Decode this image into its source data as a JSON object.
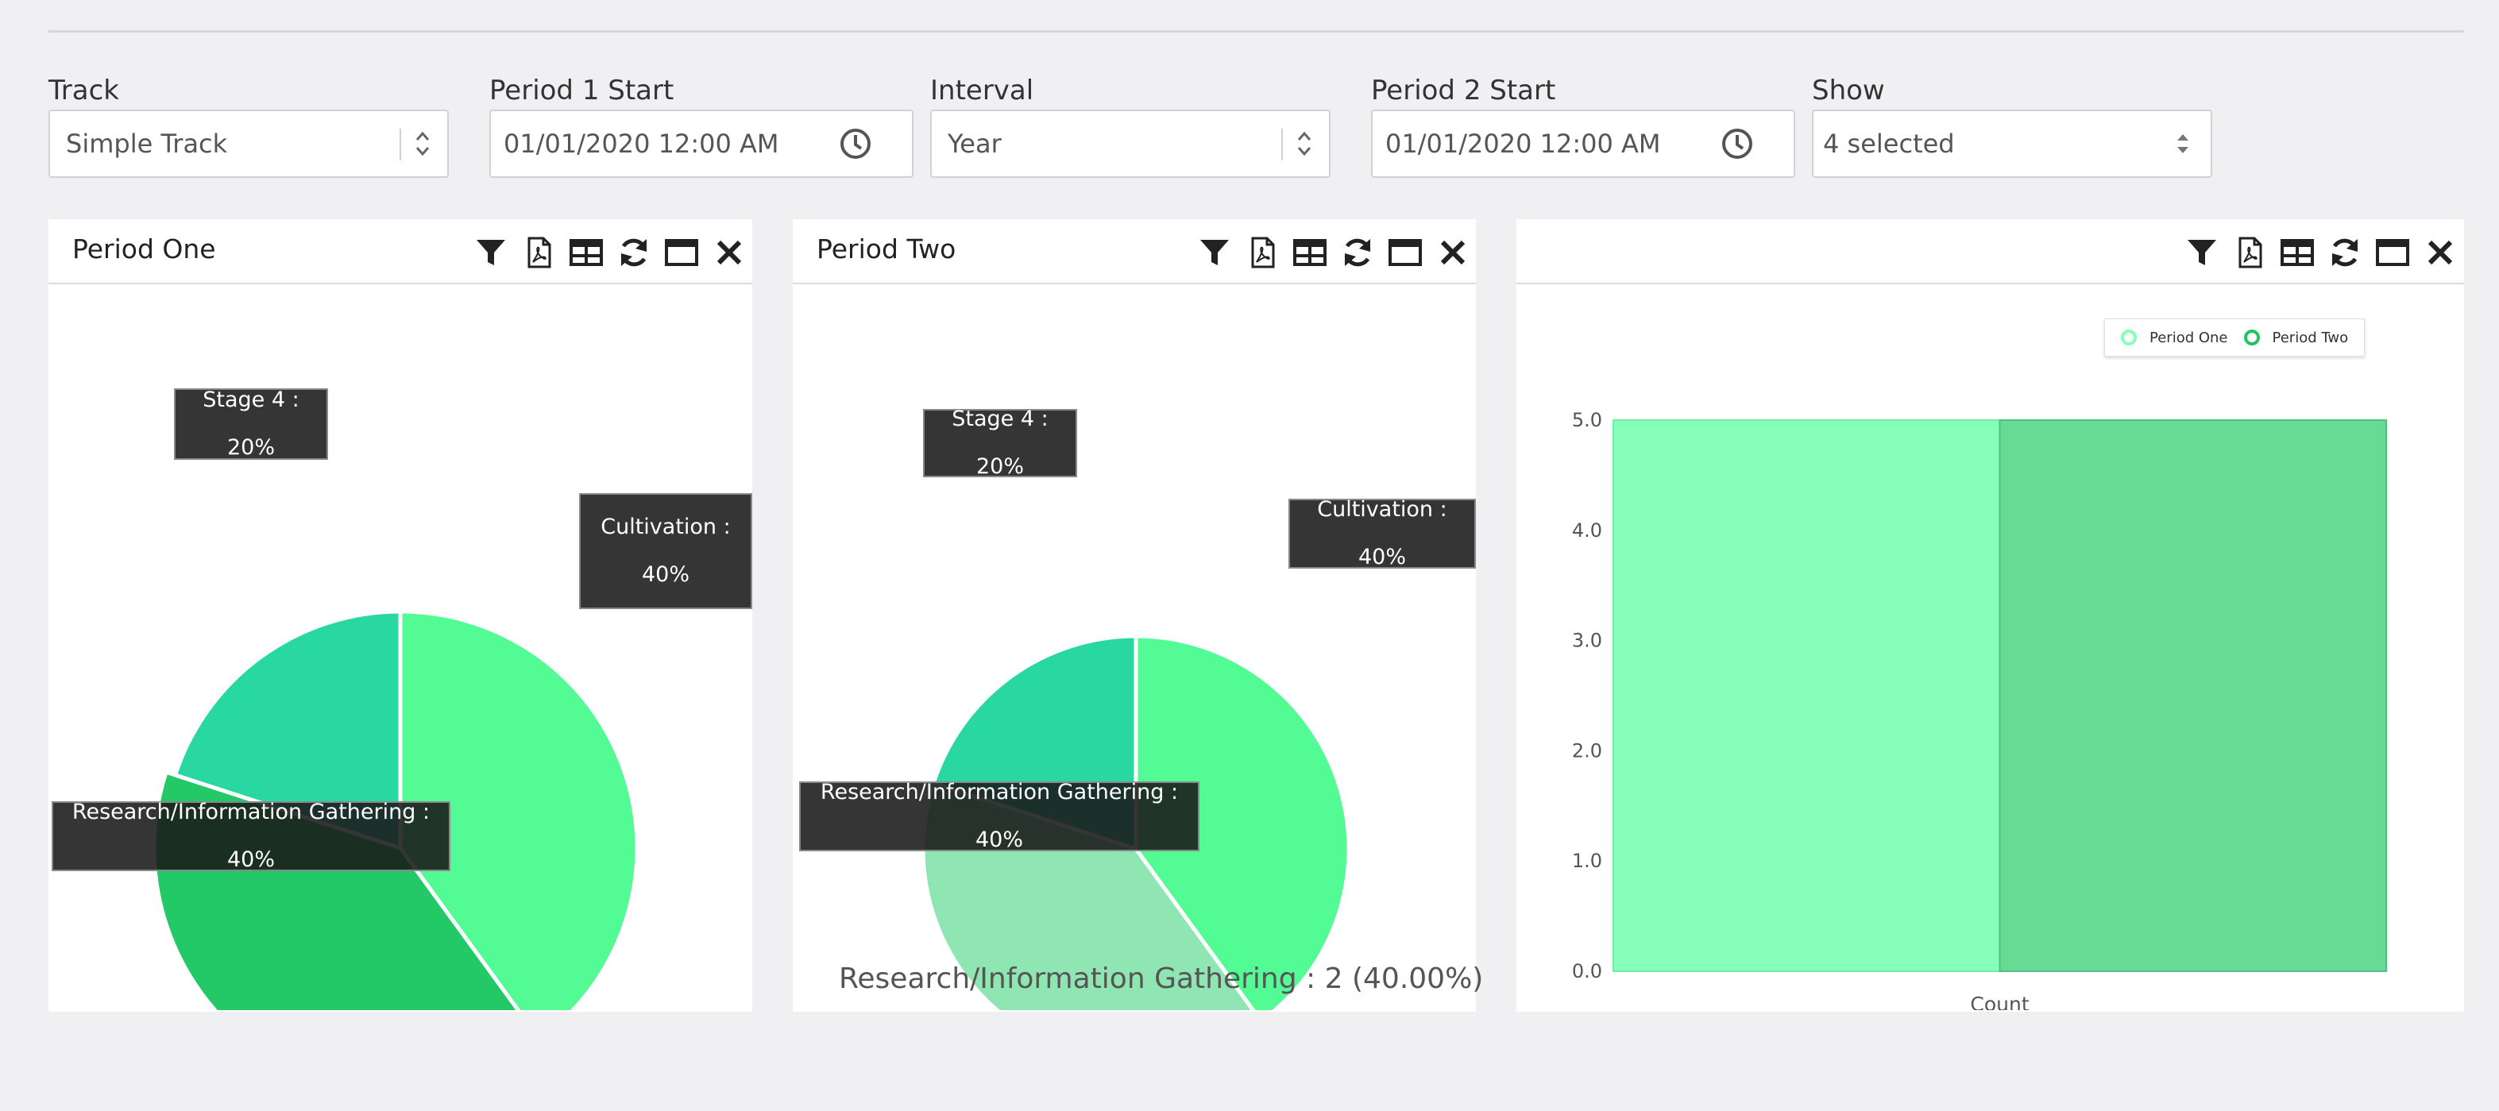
{
  "filters": {
    "track": {
      "label": "Track",
      "value": "Simple Track"
    },
    "period1": {
      "label": "Period 1 Start",
      "value": "01/01/2020 12:00 AM"
    },
    "interval": {
      "label": "Interval",
      "value": "Year"
    },
    "period2": {
      "label": "Period 2 Start",
      "value": "01/01/2020 12:00 AM"
    },
    "show": {
      "label": "Show",
      "value": "4 selected"
    }
  },
  "icons": [
    "filter-icon",
    "pdf-icon",
    "table-icon",
    "refresh-icon",
    "maximize-icon",
    "close-icon"
  ],
  "panels": [
    {
      "title": "Period One",
      "tooltips": {
        "stage4": "Stage 4 : 20%",
        "cultivation_l1": "Cultivation :",
        "cultivation_l2": "40%",
        "research": "Research/Information Gathering : 40%"
      }
    },
    {
      "title": "Period Two",
      "tooltips": {
        "stage4": "Stage 4 : 20%",
        "cultivation": "Cultivation : 40%",
        "research": "Research/Information Gathering : 40%"
      },
      "caption": "Research/Information Gathering : 2 (40.00%)"
    },
    {
      "title": ""
    }
  ],
  "chart_data": [
    {
      "type": "pie",
      "slices": [
        {
          "label": "Cultivation",
          "percent": 40,
          "color": "#52fb94"
        },
        {
          "label": "Research/Information Gathering",
          "percent": 40,
          "color": "#23c967"
        },
        {
          "label": "Stage 4",
          "percent": 20,
          "color": "#29d7a0"
        }
      ]
    },
    {
      "type": "pie",
      "slices": [
        {
          "label": "Cultivation",
          "percent": 40,
          "color": "#52fb94"
        },
        {
          "label": "Research/Information Gathering",
          "percent": 40,
          "color": "#8fe6b3",
          "value": 2
        },
        {
          "label": "Stage 4",
          "percent": 20,
          "color": "#29d7a0"
        }
      ]
    },
    {
      "type": "bar",
      "categories": [
        "Count"
      ],
      "series": [
        {
          "name": "Period One",
          "values": [
            5
          ],
          "color": "#86ffbb"
        },
        {
          "name": "Period Two",
          "values": [
            5
          ],
          "color": "#67da96"
        }
      ],
      "ylim": [
        0,
        5
      ],
      "yticks": [
        "0.0",
        "1.0",
        "2.0",
        "3.0",
        "4.0",
        "5.0"
      ],
      "grid": true,
      "legend": "top-right"
    }
  ]
}
